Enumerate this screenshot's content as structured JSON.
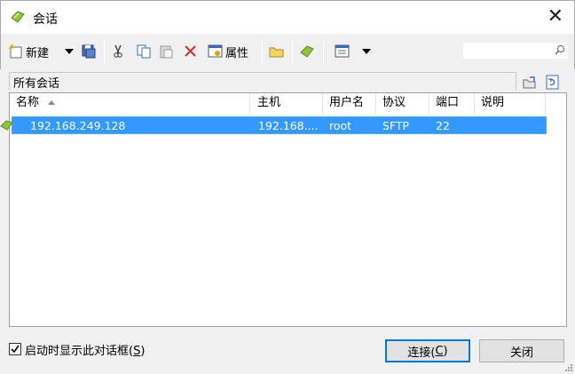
{
  "window": {
    "title": "会话",
    "close_glyph": "✕",
    "icon": "sessions-icon"
  },
  "toolbar": {
    "new_label": "新建",
    "properties_label": "属性",
    "items": [
      "new-session-icon",
      "dropdown-arrow",
      "save-icon",
      "cut-icon",
      "copy-icon",
      "paste-icon",
      "delete-icon",
      "properties-icon",
      "folder-icon",
      "sessions-icon",
      "view-icon",
      "dropdown-arrow"
    ]
  },
  "search": {
    "value": "",
    "placeholder": ""
  },
  "folder": {
    "path": "所有会话"
  },
  "table": {
    "columns": [
      "名称",
      "主机",
      "用户名",
      "协议",
      "端口",
      "说明"
    ],
    "sort_column": "名称",
    "sort_direction": "ascending",
    "rows": [
      {
        "name": "192.168.249.128",
        "host": "192.168....",
        "username": "root",
        "protocol": "SFTP",
        "port": "22",
        "description": "",
        "selected": true
      }
    ]
  },
  "startup_checkbox": {
    "label_prefix": "启动时显示此对话框(",
    "label_key": "S",
    "label_suffix": ")",
    "checked": true
  },
  "buttons": {
    "connect_prefix": "连接(",
    "connect_key": "C",
    "connect_suffix": ")",
    "close": "关闭"
  },
  "colors": {
    "selection": "#3399ff",
    "default_button_border": "#0078d7",
    "accent_green": "#7fb93a"
  }
}
